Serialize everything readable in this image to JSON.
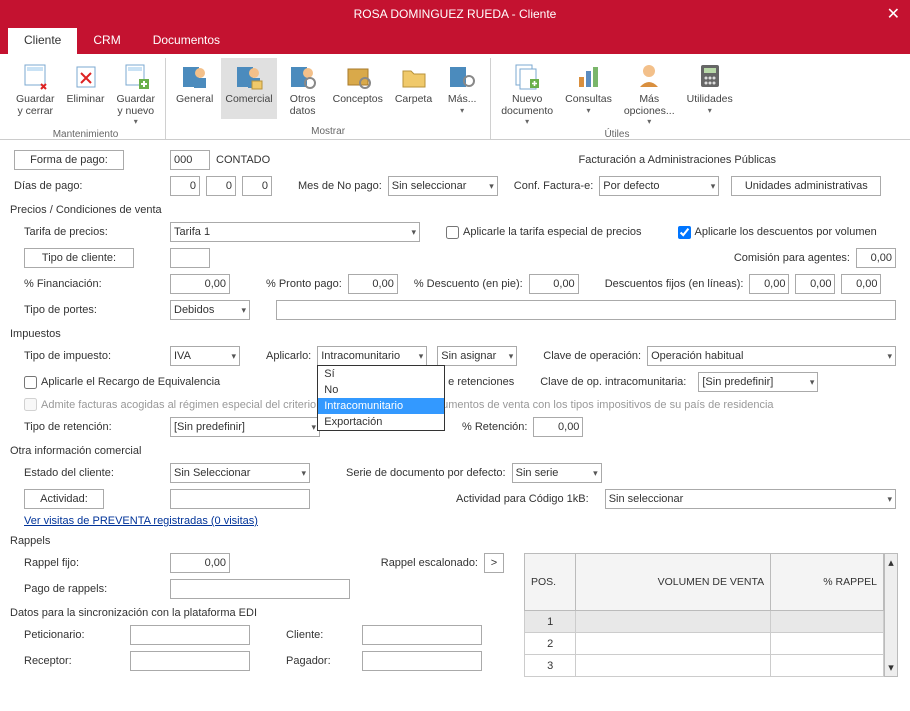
{
  "window": {
    "title": "ROSA DOMINGUEZ RUEDA - Cliente"
  },
  "tabs": [
    "Cliente",
    "CRM",
    "Documentos"
  ],
  "ribbon": {
    "mantenimiento": {
      "title": "Mantenimiento",
      "guardar_cerrar": "Guardar\ny cerrar",
      "eliminar": "Eliminar",
      "guardar_nuevo": "Guardar\ny nuevo"
    },
    "mostrar": {
      "title": "Mostrar",
      "general": "General",
      "comercial": "Comercial",
      "otros": "Otros\ndatos",
      "conceptos": "Conceptos",
      "carpeta": "Carpeta",
      "mas": "Más..."
    },
    "utiles": {
      "title": "Útiles",
      "nuevo_doc": "Nuevo\ndocumento",
      "consultas": "Consultas",
      "mas_op": "Más\nopciones...",
      "utilidades": "Utilidades"
    }
  },
  "pago": {
    "forma_label": "Forma de pago:",
    "forma_code": "000",
    "forma_text": "CONTADO",
    "fact_admin": "Facturación a Administraciones Públicas",
    "dias_label": "Días de pago:",
    "d1": "0",
    "d2": "0",
    "d3": "0",
    "mes_no_label": "Mes de No pago:",
    "mes_no": "Sin seleccionar",
    "conf_label": "Conf. Factura-e:",
    "conf": "Por defecto",
    "unidades": "Unidades administrativas"
  },
  "precios": {
    "hdr": "Precios / Condiciones de venta",
    "tarifa_label": "Tarifa de precios:",
    "tarifa": "Tarifa 1",
    "chk_especial": "Aplicarle la tarifa especial de precios",
    "chk_volumen": "Aplicarle los descuentos por volumen",
    "tipo_cliente_label": "Tipo de cliente:",
    "comision_label": "Comisión para agentes:",
    "comision": "0,00",
    "financiacion_label": "% Financiación:",
    "financiacion": "0,00",
    "pronto_label": "% Pronto pago:",
    "pronto": "0,00",
    "descuento_label": "% Descuento (en pie):",
    "descuento": "0,00",
    "desc_fijos_label": "Descuentos fijos (en líneas):",
    "df1": "0,00",
    "df2": "0,00",
    "df3": "0,00",
    "portes_label": "Tipo de portes:",
    "portes": "Debidos"
  },
  "impuestos": {
    "hdr": "Impuestos",
    "tipo_label": "Tipo de impuesto:",
    "tipo": "IVA",
    "aplicarlo_label": "Aplicarlo:",
    "aplicarlo": "Intracomunitario",
    "dd_options": [
      "Sí",
      "No",
      "Intracomunitario",
      "Exportación"
    ],
    "sin_asignar": "Sin asignar",
    "clave_op_label": "Clave de operación:",
    "clave_op": "Operación habitual",
    "chk_recargo": "Aplicarle el Recargo de Equivalencia",
    "retenciones_tail": "e retenciones",
    "clave_intra_label": "Clave de op. intracomunitaria:",
    "clave_intra": "[Sin predefinir]",
    "chk_admite": "Admite facturas acogidas al régimen especial del criterio",
    "admite_tail": "umentos de venta con los tipos impositivos de su país de residencia",
    "tipo_ret_label": "Tipo de retención:",
    "tipo_ret": "[Sin predefinir]",
    "pct_ret_label": "% Retención:",
    "pct_ret": "0,00"
  },
  "otra": {
    "hdr": "Otra información comercial",
    "estado_label": "Estado del cliente:",
    "estado": "Sin Seleccionar",
    "serie_label": "Serie de documento por defecto:",
    "serie": "Sin serie",
    "actividad_btn": "Actividad:",
    "act_1kb_label": "Actividad para Código 1kB:",
    "act_1kb": "Sin seleccionar",
    "preventa": "Ver visitas de PREVENTA registradas (0 visitas)"
  },
  "rappels": {
    "hdr": "Rappels",
    "fijo_label": "Rappel fijo:",
    "fijo": "0,00",
    "escalonado_label": "Rappel escalonado:",
    "pago_label": "Pago de rappels:",
    "cols": {
      "pos": "POS.",
      "vol": "VOLUMEN DE VENTA",
      "pct": "% RAPPEL"
    },
    "rows": [
      "1",
      "2",
      "3"
    ]
  },
  "edi": {
    "hdr": "Datos para la sincronización con la plataforma EDI",
    "peticionario": "Peticionario:",
    "cliente": "Cliente:",
    "receptor": "Receptor:",
    "pagador": "Pagador:"
  }
}
